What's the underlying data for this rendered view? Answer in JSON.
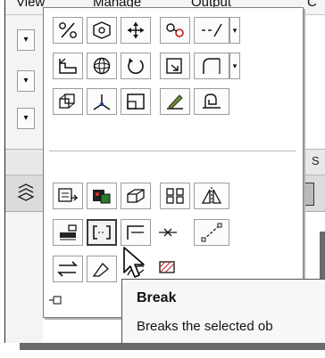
{
  "menu": {
    "items": [
      "View",
      "Manage",
      "Output",
      "C"
    ]
  },
  "panel": {
    "rows": [
      [
        "percent-icon",
        "orbit-icon",
        "pan-icon",
        "link-icon",
        "line-type-icon"
      ],
      [
        "floor-icon",
        "sphere-icon",
        "rotate-icon",
        "export-icon",
        "fillet-icon"
      ],
      [
        "group-icon",
        "vertex-icon",
        "region-icon",
        "pen-icon",
        "signature-icon"
      ]
    ],
    "modify_rows": [
      [
        "paste-icon",
        "match-icon",
        "3d-icon",
        "array-icon",
        "mirror-icon"
      ],
      [
        "align-icon",
        "break-icon",
        "extend-icon",
        "join-icon",
        "line-icon"
      ],
      [
        "swap-icon",
        "stretch-icon",
        "scale-icon",
        "hatch-icon"
      ]
    ],
    "hovered": "break-icon"
  },
  "tooltip": {
    "title": "Break",
    "description": "Breaks the selected ob"
  },
  "side_label": "S"
}
